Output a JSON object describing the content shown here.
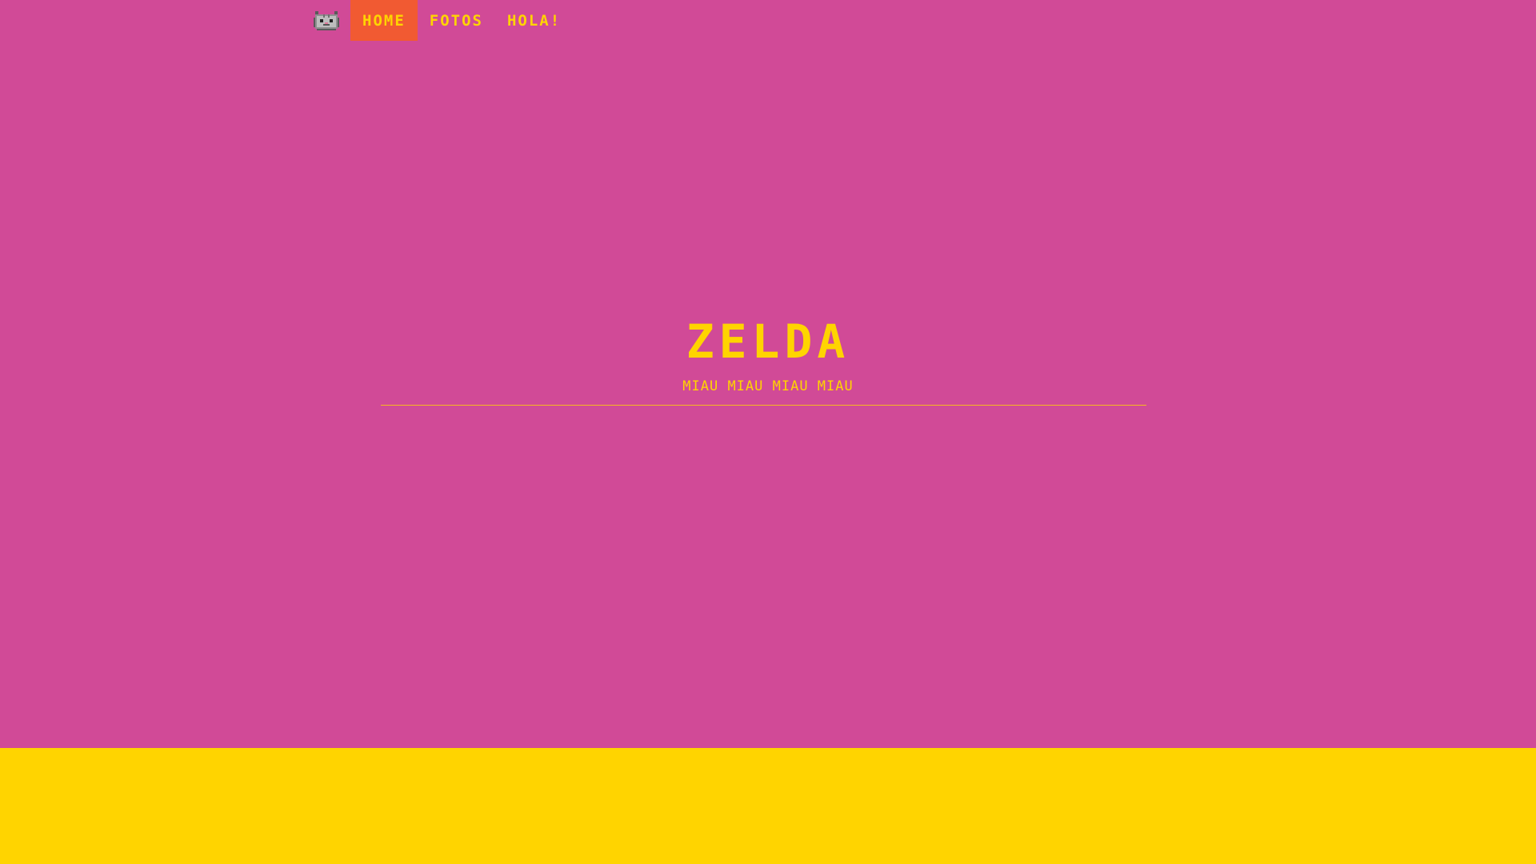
{
  "colors": {
    "background": "#d14a97",
    "accent": "#ffd400",
    "active_nav": "#f15a32",
    "footer": "#ffd400"
  },
  "navbar": {
    "brand_icon": "cat-icon",
    "items": [
      {
        "label": "HOME",
        "active": true
      },
      {
        "label": "FOTOS",
        "active": false
      },
      {
        "label": "HOLA!",
        "active": false
      }
    ]
  },
  "hero": {
    "title": "ZELDA",
    "subtitle": "MIAU MIAU MIAU MIAU"
  }
}
